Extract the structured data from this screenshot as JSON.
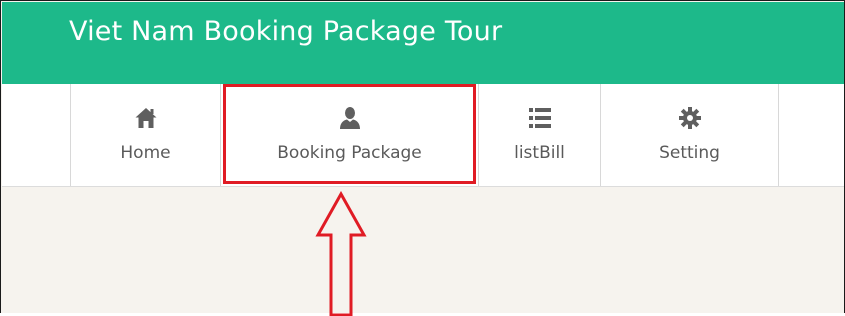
{
  "header": {
    "title": "Viet Nam Booking Package Tour",
    "background": "#1db98a"
  },
  "nav": {
    "items": [
      {
        "label": "Home",
        "icon": "home-icon"
      },
      {
        "label": "Booking Package",
        "icon": "user-icon"
      },
      {
        "label": "listBill",
        "icon": "list-icon"
      },
      {
        "label": "Setting",
        "icon": "gear-icon"
      }
    ]
  },
  "annotation": {
    "color": "#e01b24",
    "target": "Booking Package"
  }
}
